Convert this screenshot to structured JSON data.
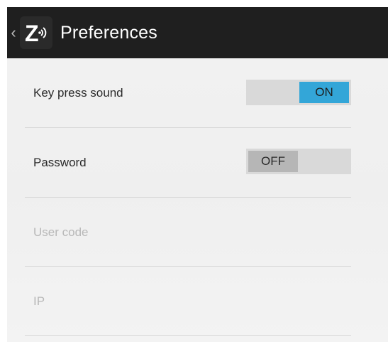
{
  "action_bar": {
    "title": "Preferences",
    "up_icon": "chevron-left-icon",
    "app_icon": "z-sound-logo-icon",
    "logo_letter": "Z"
  },
  "colors": {
    "action_bar_bg": "#1f1f1f",
    "toggle_on": "#33a6d8",
    "toggle_off_thumb": "#b6b6b6",
    "toggle_track": "#d9d9d9",
    "disabled_text": "#b8b8b8"
  },
  "preferences": {
    "key_press_sound": {
      "label": "Key press sound",
      "state": "ON"
    },
    "password": {
      "label": "Password",
      "state": "OFF"
    },
    "user_code": {
      "label": "User code"
    },
    "ip": {
      "label": "IP"
    }
  }
}
